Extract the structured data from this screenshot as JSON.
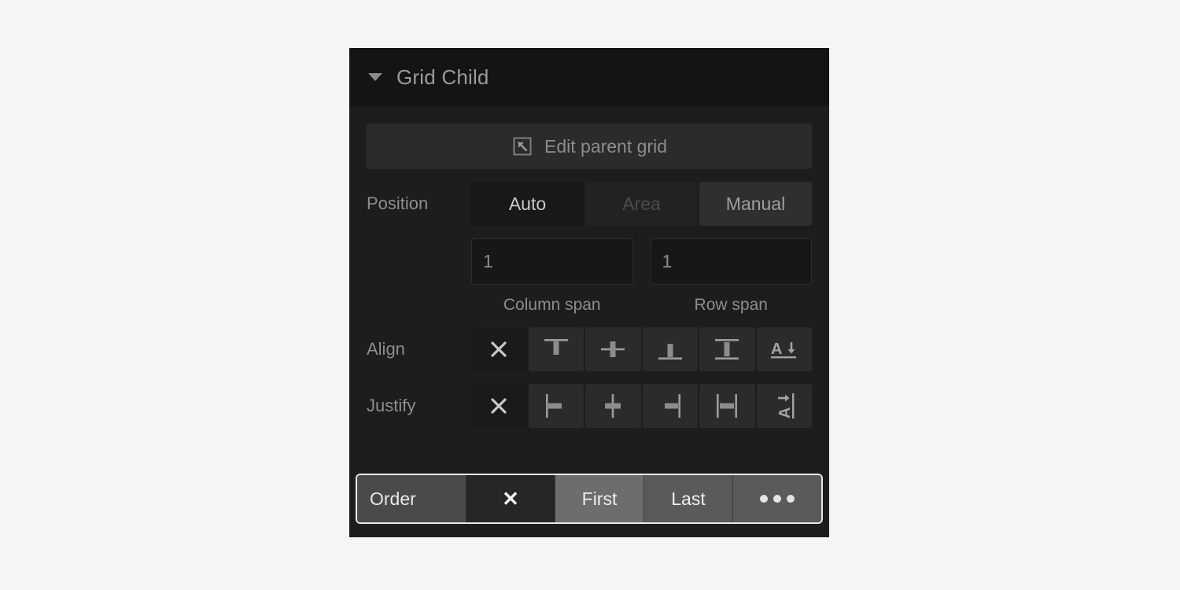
{
  "panel": {
    "title": "Grid Child",
    "disclosure_icon": "triangle-down-icon",
    "edit_parent": {
      "label": "Edit parent grid",
      "icon": "cursor-in-box-icon"
    },
    "position": {
      "label": "Position",
      "options": [
        {
          "label": "Auto",
          "state": "selected"
        },
        {
          "label": "Area",
          "state": "disabled"
        },
        {
          "label": "Manual",
          "state": "light"
        }
      ]
    },
    "spans": [
      {
        "value": "1",
        "caption": "Column span",
        "placeholder": "1"
      },
      {
        "value": "1",
        "caption": "Row span",
        "placeholder": "1"
      }
    ],
    "align": {
      "label": "Align",
      "options": [
        {
          "icon": "clear-x-icon",
          "name": "align-clear",
          "state": "selected"
        },
        {
          "icon": "align-top-icon",
          "name": "align-start",
          "state": "normal"
        },
        {
          "icon": "align-vertical-center-icon",
          "name": "align-center",
          "state": "normal"
        },
        {
          "icon": "align-bottom-icon",
          "name": "align-end",
          "state": "normal"
        },
        {
          "icon": "align-stretch-vertical-icon",
          "name": "align-stretch",
          "state": "normal"
        },
        {
          "icon": "align-baseline-icon",
          "name": "align-baseline",
          "state": "normal"
        }
      ]
    },
    "justify": {
      "label": "Justify",
      "options": [
        {
          "icon": "clear-x-icon",
          "name": "justify-clear",
          "state": "selected"
        },
        {
          "icon": "justify-left-icon",
          "name": "justify-start",
          "state": "normal"
        },
        {
          "icon": "justify-horizontal-center-icon",
          "name": "justify-center",
          "state": "normal"
        },
        {
          "icon": "justify-right-icon",
          "name": "justify-end",
          "state": "normal"
        },
        {
          "icon": "justify-stretch-horizontal-icon",
          "name": "justify-stretch",
          "state": "normal"
        },
        {
          "icon": "justify-baseline-icon",
          "name": "justify-baseline",
          "state": "normal"
        }
      ]
    },
    "order": {
      "label": "Order",
      "options": [
        {
          "label": "✕",
          "name": "order-clear",
          "state": "selected"
        },
        {
          "label": "First",
          "name": "order-first",
          "state": "hover"
        },
        {
          "label": "Last",
          "name": "order-last",
          "state": "normal"
        },
        {
          "label": "",
          "name": "order-more",
          "state": "normal",
          "icon": "ellipsis-icon"
        }
      ]
    }
  },
  "colors": {
    "page_background": "#f4f5f7",
    "panel_background": "#1d1d1d",
    "header_background": "#141414",
    "control_background": "#2b2b2b",
    "selected_background": "#1a1a1a",
    "highlight_border": "#e8e8e8",
    "text": "#8d8d8d",
    "text_bright": "#efefef"
  }
}
